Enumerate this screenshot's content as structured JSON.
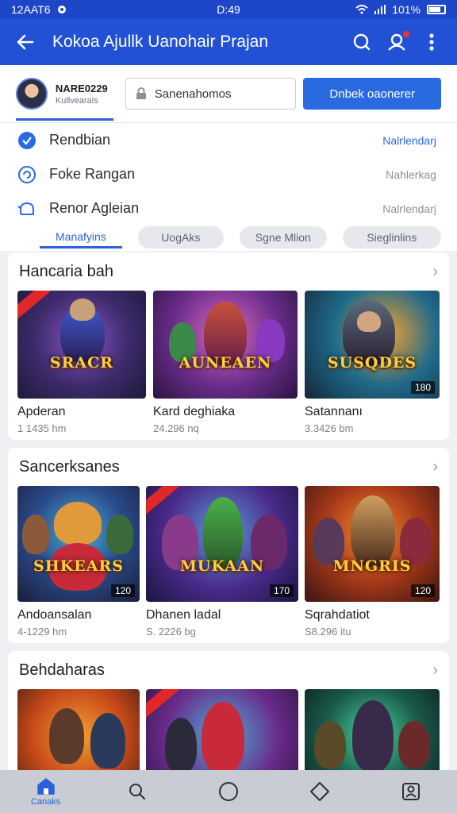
{
  "status_bar": {
    "time_left": "12AAT6",
    "time_center": "D:49",
    "battery": "101%"
  },
  "app_bar": {
    "title": "Kokoa Ajullk Uanohair Prajan"
  },
  "profile": {
    "name": "NARE0229",
    "subtitle": "Kullvearals",
    "search_placeholder": "Sanenahomos",
    "cta_label": "Dnbek oaonerer"
  },
  "list": [
    {
      "label": "Rendbian",
      "value": "Nalrlendarj"
    },
    {
      "label": "Foke Rangan",
      "value": "Nahlerkag"
    },
    {
      "label": "Renor Agleian",
      "value": "Nalrlendarj"
    }
  ],
  "chips": [
    {
      "label": "Manafyins"
    },
    {
      "label": "UogAks"
    },
    {
      "label": "Sgne Mlion"
    },
    {
      "label": "Sieglinlins"
    }
  ],
  "sections": [
    {
      "title": "Hancaria bah",
      "items": [
        {
          "name": "Apderan",
          "meta": "1 1435 hm",
          "logo": "SRACR",
          "badge": ""
        },
        {
          "name": "Kard deghiaka",
          "meta": "24.296 nq",
          "logo": "AUNEAEN",
          "badge": ""
        },
        {
          "name": "Satannanı",
          "meta": "3.3426 bm",
          "logo": "SUSQDES",
          "badge": "180"
        }
      ]
    },
    {
      "title": "Sancerksanes",
      "items": [
        {
          "name": "Andoansalan",
          "meta": "4-1229 hm",
          "logo": "SHKEARS",
          "badge": "120"
        },
        {
          "name": "Dhanen ladal",
          "meta": "S. 2226 bg",
          "logo": "MUKAAN",
          "badge": "170"
        },
        {
          "name": "Sqrahdatiot",
          "meta": "S8.296 itu",
          "logo": "MNGRIS",
          "badge": "120"
        }
      ]
    },
    {
      "title": "Behdaharas",
      "items": [
        {
          "name": "",
          "meta": "",
          "logo": "",
          "badge": ""
        },
        {
          "name": "",
          "meta": "",
          "logo": "",
          "badge": ""
        },
        {
          "name": "",
          "meta": "",
          "logo": "",
          "badge": ""
        }
      ]
    }
  ],
  "bottom_nav": [
    {
      "label": "Canaks",
      "icon": "home-icon"
    },
    {
      "label": "",
      "icon": "search-icon"
    },
    {
      "label": "",
      "icon": "circle-icon"
    },
    {
      "label": "",
      "icon": "diamond-icon"
    },
    {
      "label": "",
      "icon": "profile-icon"
    }
  ],
  "colors": {
    "brand": "#2251d6",
    "accent": "#2a6ae0"
  }
}
